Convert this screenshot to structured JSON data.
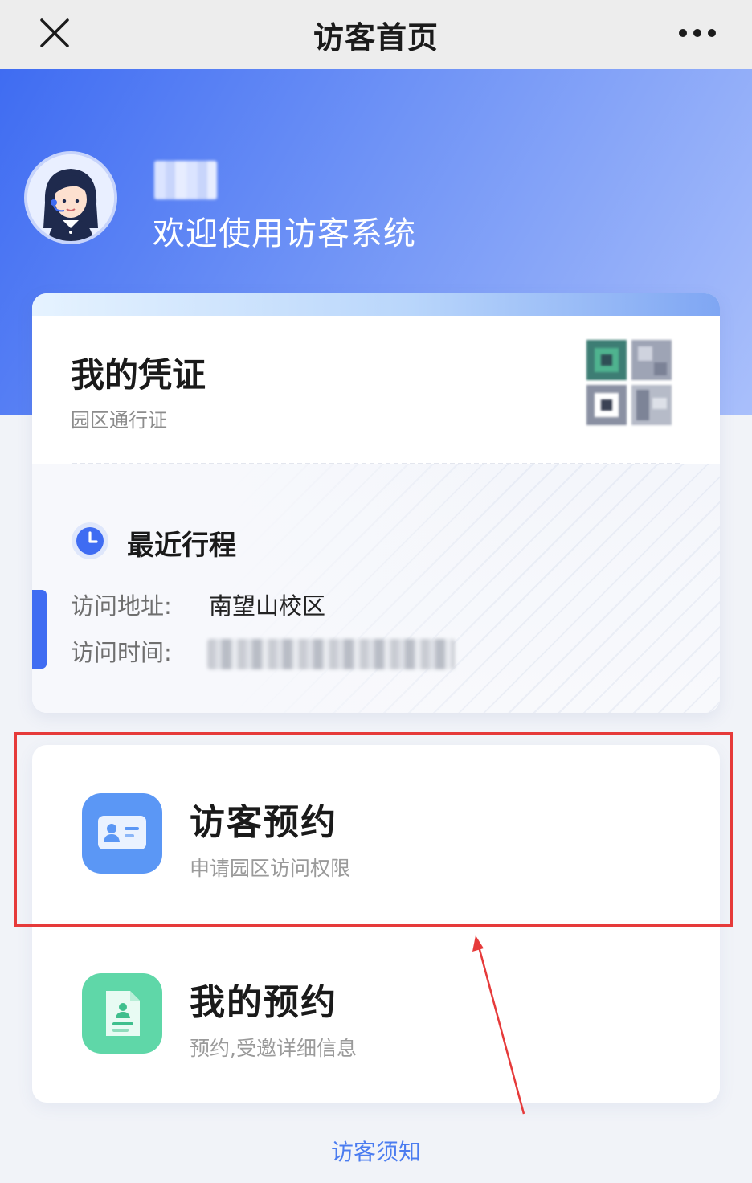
{
  "nav": {
    "title": "访客首页",
    "close_icon": "close-icon",
    "more_icon": "more-horizontal-icon"
  },
  "hero": {
    "welcome": "欢迎使用访客系统",
    "avatar_icon": "avatar-illustration"
  },
  "credential": {
    "title": "我的凭证",
    "subtitle": "园区通行证",
    "qr_icon": "qr-code-icon"
  },
  "recent_trip": {
    "title": "最近行程",
    "clock_icon": "clock-icon",
    "address_label": "访问地址:",
    "address_value": "南望山校区",
    "time_label": "访问时间:"
  },
  "actions": [
    {
      "title": "访客预约",
      "subtitle": "申请园区访问权限",
      "icon": "id-card-icon",
      "color": "#5b97f5"
    },
    {
      "title": "我的预约",
      "subtitle": "预约,受邀详细信息",
      "icon": "document-user-icon",
      "color": "#5fd7a8"
    }
  ],
  "footer": {
    "notice_link": "访客须知"
  },
  "colors": {
    "primary": "#3f6cf2",
    "annotation": "#e63a3a",
    "link": "#4b7cf0"
  }
}
